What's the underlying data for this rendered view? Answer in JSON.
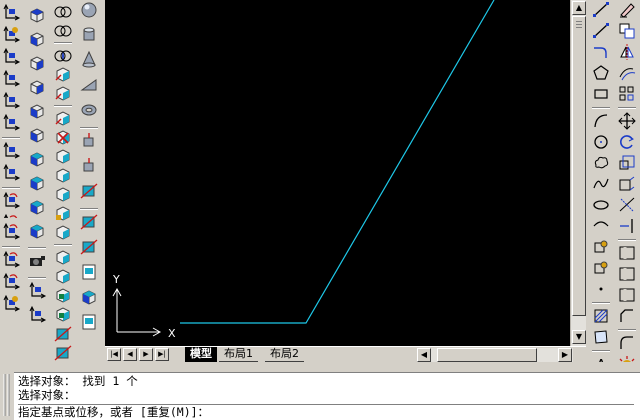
{
  "canvas": {
    "background": "#000000",
    "line_color": "#1ec8e8",
    "ucs_color": "#ffffff",
    "ucs_y_label": "Y",
    "ucs_x_label": "X"
  },
  "layout_tabs": [
    {
      "label": "模型",
      "active": true
    },
    {
      "label": "布局1",
      "active": false
    },
    {
      "label": "布局2",
      "active": false
    }
  ],
  "command_window": {
    "lines": [
      "选择对象： 找到 1 个",
      "选择对象：",
      "指定基点或位移，或者 [重复(M)]："
    ]
  },
  "toolbars": {
    "ucs_icons": [
      "ucs-icon",
      "ucs-previous-icon",
      "ucs-named-icon",
      "ucs-world-icon",
      "ucs-object-icon",
      "ucs-face-icon",
      "ucs-view-icon",
      "ucs-origin-icon",
      "ucs-zaxis-icon",
      "ucs-3point-icon",
      "ucs-x-rotate-icon",
      "ucs-y-rotate-icon",
      "ucs-z-rotate-icon",
      "ucs-apply-icon"
    ],
    "view_icons": [
      "top-view-icon",
      "bottom-view-icon",
      "left-view-icon",
      "right-view-icon",
      "front-view-icon",
      "back-view-icon",
      "sw-iso-icon",
      "se-iso-icon",
      "ne-iso-icon",
      "nw-iso-icon",
      "camera-icon",
      "ucs-display-icon",
      "ucs-move-icon"
    ],
    "edit3d_icons": [
      "union-icon",
      "subtract-icon",
      "intersect-icon",
      "extrude-face-icon",
      "move-face-icon",
      "offset-face-icon",
      "delete-face-icon",
      "rotate-face-icon",
      "taper-face-icon",
      "copy-face-icon",
      "color-face-icon",
      "imprint-icon",
      "clean-icon",
      "separate-icon",
      "shell-icon",
      "check-icon",
      "slice-icon",
      "section-icon",
      "interfere-icon"
    ],
    "solids_icons": [
      "sphere-icon",
      "cylinder-icon",
      "cone-icon",
      "wedge-icon",
      "torus-icon",
      "extrude-icon",
      "revolve-icon",
      "slice-solid-icon",
      "section-solid-icon",
      "interference-icon",
      "setup-drawing-icon",
      "setup-view-icon",
      "setup-profile-icon"
    ],
    "draw_icons": [
      "line-icon",
      "construction-line-icon",
      "polyline-icon",
      "polygon-icon",
      "rectangle-icon",
      "arc-icon",
      "circle-icon",
      "revision-cloud-icon",
      "spline-icon",
      "ellipse-icon",
      "ellipse-arc-icon",
      "insert-block-icon",
      "make-block-icon",
      "point-icon",
      "hatch-icon",
      "region-icon",
      "multiline-text-icon"
    ],
    "modify_icons": [
      "erase-icon",
      "copy-icon",
      "mirror-icon",
      "offset-icon",
      "array-icon",
      "move-icon",
      "rotate-icon",
      "scale-icon",
      "stretch-icon",
      "trim-icon",
      "extend-icon",
      "break-at-point-icon",
      "break-icon",
      "join-icon",
      "chamfer-icon",
      "fillet-icon",
      "explode-icon"
    ]
  }
}
